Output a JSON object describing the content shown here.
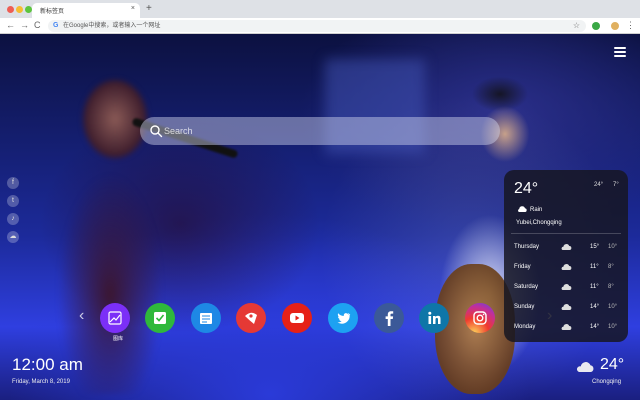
{
  "browser": {
    "tab_title": "新标签页",
    "tab_close": "×",
    "new_tab": "+",
    "back": "←",
    "forward": "→",
    "reload": "C",
    "google_glyph": "G",
    "omnibox_placeholder": "在Google中搜索，或者输入一个网址",
    "bookmark_star": "☆",
    "kebab": "⋮",
    "traffic_colors": [
      "#ee5e54",
      "#f5bd32",
      "#5cc53e"
    ]
  },
  "search": {
    "placeholder": "Search",
    "icon": "search-icon"
  },
  "social_links": [
    {
      "name": "facebook",
      "glyph": "f"
    },
    {
      "name": "twitter",
      "glyph": "t"
    },
    {
      "name": "notify",
      "glyph": "♪"
    },
    {
      "name": "wechat",
      "glyph": "☁"
    }
  ],
  "shortcuts": [
    {
      "name": "gallery",
      "label": "图库",
      "color": "#7b2ff7",
      "icon": "gallery-icon"
    },
    {
      "name": "tasks",
      "label": "",
      "color": "#2fb83b",
      "icon": "check-icon"
    },
    {
      "name": "notes",
      "label": "",
      "color": "#1e88e5",
      "icon": "notes-icon"
    },
    {
      "name": "games",
      "label": "",
      "color": "#e53935",
      "icon": "game-icon"
    },
    {
      "name": "youtube",
      "label": "",
      "color": "#e62117",
      "icon": "youtube-icon"
    },
    {
      "name": "twitter",
      "label": "",
      "color": "#1da1f2",
      "icon": "twitter-icon"
    },
    {
      "name": "facebook",
      "label": "",
      "color": "#3b5998",
      "icon": "facebook-icon"
    },
    {
      "name": "linkedin",
      "label": "",
      "color": "#0e76a8",
      "icon": "linkedin-icon"
    },
    {
      "name": "instagram",
      "label": "",
      "color": "#d6249f",
      "icon": "instagram-icon"
    }
  ],
  "shortcut_prev": "‹",
  "shortcut_next": "›",
  "weather_panel": {
    "temp": "24°",
    "high": "24°",
    "low": "7°",
    "condition": "Rain",
    "location": "Yubei,Chongqing",
    "forecast": [
      {
        "day": "Thursday",
        "hi": "15°",
        "lo": "10°"
      },
      {
        "day": "Friday",
        "hi": "11°",
        "lo": "8°"
      },
      {
        "day": "Saturday",
        "hi": "11°",
        "lo": "8°"
      },
      {
        "day": "Sunday",
        "hi": "14°",
        "lo": "10°"
      },
      {
        "day": "Monday",
        "hi": "14°",
        "lo": "10°"
      }
    ]
  },
  "clock": {
    "time": "12:00 am",
    "date": "Friday, March 8, 2019"
  },
  "bottom_weather": {
    "temp": "24°",
    "city": "Chongqing",
    "icon": "cloud-icon"
  }
}
